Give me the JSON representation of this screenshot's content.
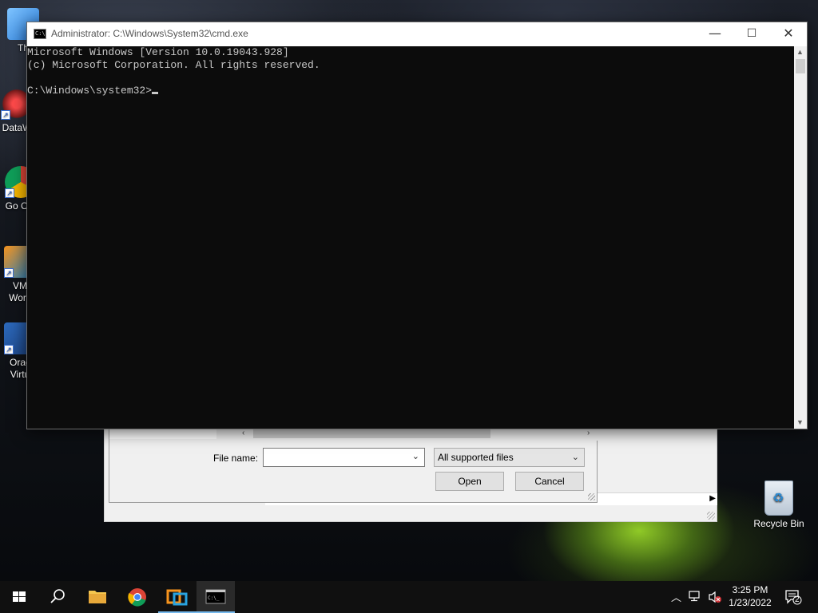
{
  "desktop": {
    "icons": [
      {
        "label": "Th"
      },
      {
        "label": "DataW"
      },
      {
        "label": "Go Chr"
      },
      {
        "label": "VM Work"
      },
      {
        "label": "Orac Virtu"
      },
      {
        "label": "Recycle Bin"
      }
    ]
  },
  "cmd": {
    "title": "Administrator: C:\\Windows\\System32\\cmd.exe",
    "lines": [
      "Microsoft Windows [Version 10.0.19043.928]",
      "(c) Microsoft Corporation. All rights reserved.",
      "",
      "C:\\Windows\\system32>"
    ],
    "caption": {
      "minimize": "—",
      "maximize": "☐",
      "close": "✕"
    }
  },
  "file_dialog": {
    "file_name_label": "File name:",
    "file_name_value": "",
    "filter_value": "All supported files",
    "open_label": "Open",
    "cancel_label": "Cancel"
  },
  "taskbar": {
    "apps": [
      "start-icon",
      "search-icon",
      "file-explorer-icon",
      "chrome-icon",
      "vmware-icon",
      "cmd-icon"
    ],
    "clock_time": "3:25 PM",
    "clock_date": "1/23/2022",
    "notification_count": "2"
  },
  "colors": {
    "taskbar_bg": "#101010",
    "console_bg": "#0c0c0c",
    "console_text": "#c8c8c8",
    "active_indicator": "#76b9ed"
  }
}
